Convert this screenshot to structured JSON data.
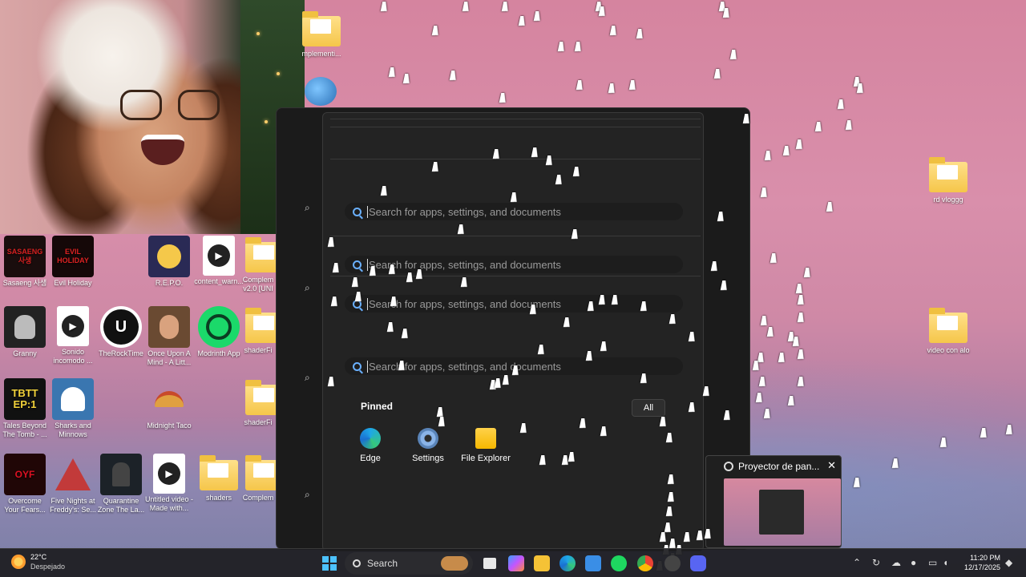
{
  "desktop": {
    "icons": [
      {
        "label": "mplementi...",
        "kind": "folder"
      },
      {
        "label": "Sasaeng 사생",
        "kind": "game"
      },
      {
        "label": "Evil Holiday",
        "kind": "game"
      },
      {
        "label": "R.E.P.O.",
        "kind": "game"
      },
      {
        "label": "content_warn...",
        "kind": "video"
      },
      {
        "label": "Complem v2.0 [UNI",
        "kind": "folder"
      },
      {
        "label": "Granny",
        "kind": "game"
      },
      {
        "label": "Sonido incomodo ...",
        "kind": "video"
      },
      {
        "label": "TheRockTime",
        "kind": "app"
      },
      {
        "label": "Once Upon A Mind - A Litt...",
        "kind": "game"
      },
      {
        "label": "Modrinth App",
        "kind": "app"
      },
      {
        "label": "shaderFi",
        "kind": "folder"
      },
      {
        "label": "Tales Beyond The Tomb - ...",
        "kind": "game"
      },
      {
        "label": "Sharks and Minnows",
        "kind": "game"
      },
      {
        "label": "Midnight Taco",
        "kind": "game"
      },
      {
        "label": "shaderFi",
        "kind": "folder"
      },
      {
        "label": "Overcome Your Fears...",
        "kind": "game"
      },
      {
        "label": "Five Nights at Freddy's: Se...",
        "kind": "game"
      },
      {
        "label": "Quarantine Zone The La...",
        "kind": "game"
      },
      {
        "label": "Untitled video - Made with...",
        "kind": "video"
      },
      {
        "label": "shaders",
        "kind": "folder"
      },
      {
        "label": "Complem",
        "kind": "folder"
      },
      {
        "label": "rd vloggg",
        "kind": "folder"
      },
      {
        "label": "video con alo",
        "kind": "folder"
      }
    ],
    "thumb_texts": {
      "sasaeng": "SASAENG 사생",
      "evil": "EVIL HOLIDAY",
      "tbtt": "TBTT EP:1"
    }
  },
  "start_menu": {
    "search_placeholder": "Search for apps, settings, and documents",
    "pinned_title": "Pinned",
    "all_button": "All",
    "pinned": [
      {
        "label": "Edge",
        "icon": "edge-icon"
      },
      {
        "label": "Settings",
        "icon": "settings-icon"
      },
      {
        "label": "File Explorer",
        "icon": "file-explorer-icon"
      }
    ]
  },
  "projector": {
    "title": "Proyector de pan...",
    "close": "✕"
  },
  "taskbar": {
    "weather_temp": "22°C",
    "weather_cond": "Despejado",
    "search_label": "Search",
    "time": "11:20 PM",
    "date": "12/17/2025"
  },
  "colors": {
    "accent": "#4cc2ff",
    "start_bg": "#232323",
    "taskbar_bg": "#1c1c20"
  }
}
